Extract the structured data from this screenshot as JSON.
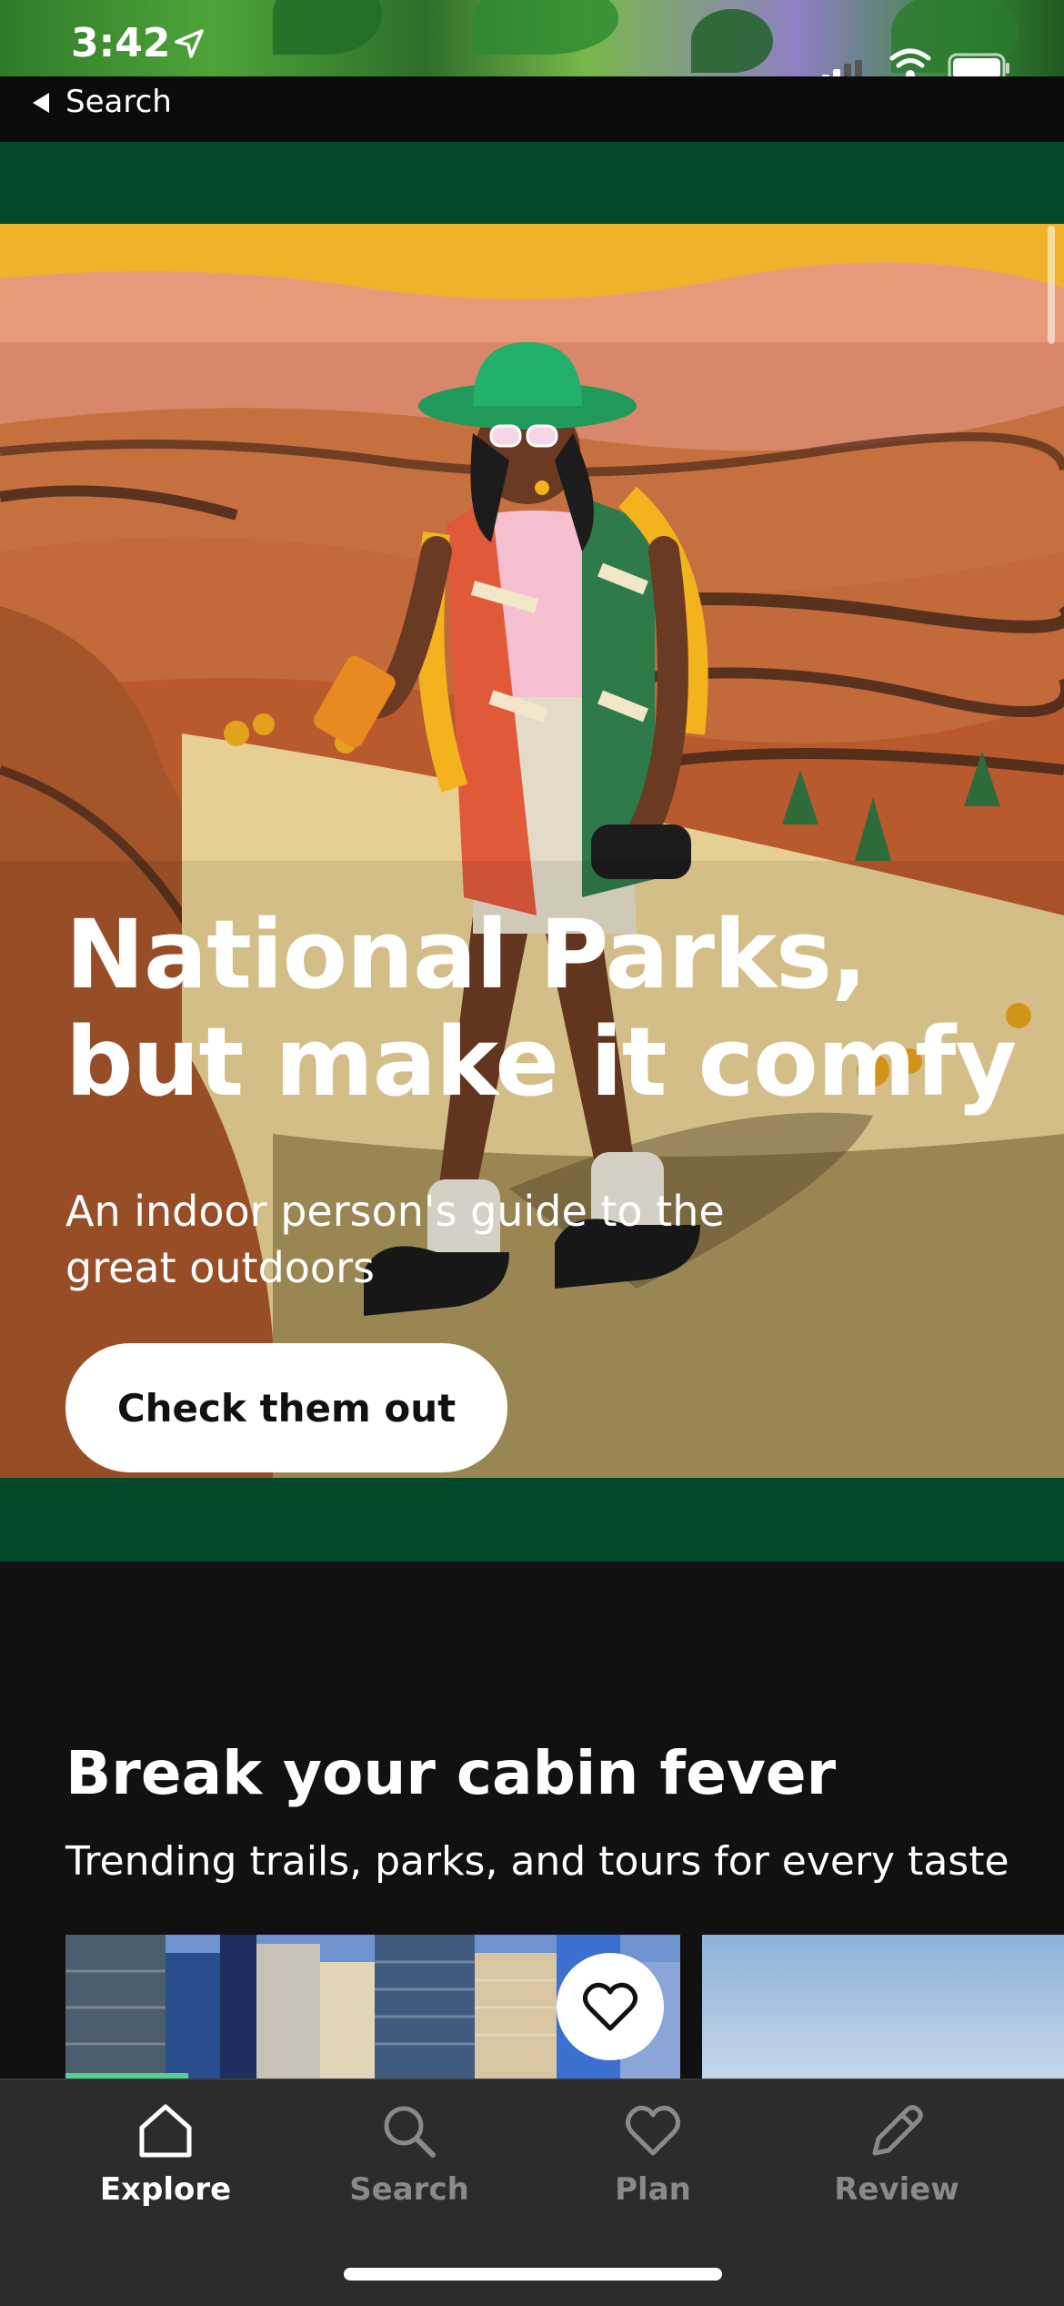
{
  "status_bar": {
    "time": "3:42",
    "back_label": "Search"
  },
  "hero": {
    "title": "National Parks, but make it comfy",
    "subtitle": "An indoor person's guide to the great outdoors",
    "button_label": "Check them out"
  },
  "section": {
    "title": "Break your cabin fever",
    "subtitle": "Trending trails, parks, and tours for every taste",
    "carousel_progress": 0.2
  },
  "tabs": [
    {
      "label": "Explore",
      "icon": "home-icon",
      "active": true
    },
    {
      "label": "Search",
      "icon": "search-icon",
      "active": false
    },
    {
      "label": "Plan",
      "icon": "heart-icon",
      "active": false
    },
    {
      "label": "Review",
      "icon": "pencil-icon",
      "active": false
    }
  ],
  "colors": {
    "brand_green": "#04482a",
    "accent_green": "#4fd38f",
    "tab_bar_bg": "#2c2c2c",
    "page_bg": "#111111"
  }
}
